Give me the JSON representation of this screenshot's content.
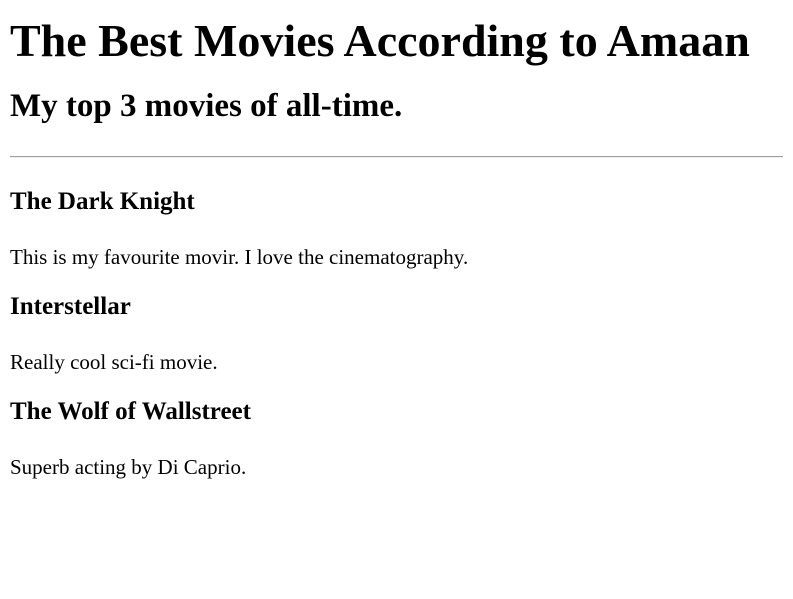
{
  "header": {
    "title": "The Best Movies According to Amaan",
    "subtitle": "My top 3 movies of all-time."
  },
  "movies": [
    {
      "title": "The Dark Knight",
      "description": "This is my favourite movir. I love the cinematography."
    },
    {
      "title": "Interstellar",
      "description": "Really cool sci-fi movie."
    },
    {
      "title": "The Wolf of Wallstreet",
      "description": "Superb acting by Di Caprio."
    }
  ]
}
